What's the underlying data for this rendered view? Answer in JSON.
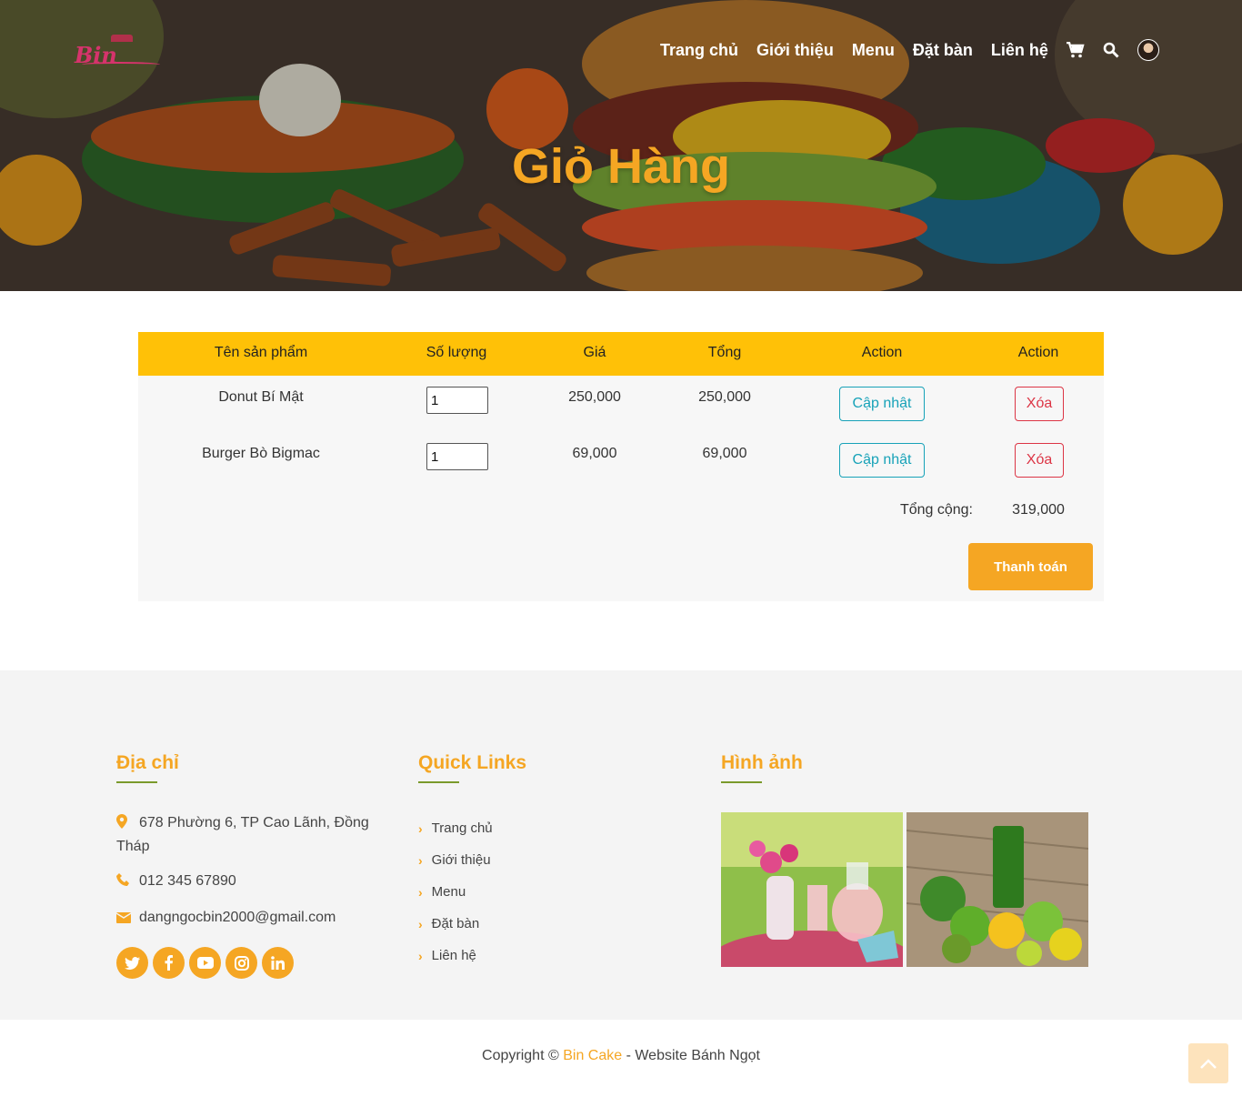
{
  "header": {
    "logo_text": "Bin",
    "nav": [
      "Trang chủ",
      "Giới thiệu",
      "Menu",
      "Đặt bàn",
      "Liên hệ"
    ],
    "icons": [
      "cart-icon",
      "search-icon",
      "avatar"
    ]
  },
  "hero": {
    "title": "Giỏ Hàng"
  },
  "cart": {
    "columns": [
      "Tên sản phẩm",
      "Số lượng",
      "Giá",
      "Tổng",
      "Action",
      "Action"
    ],
    "rows": [
      {
        "name": "Donut Bí Mật",
        "qty": "1",
        "price": "250,000",
        "total": "250,000",
        "update": "Cập nhật",
        "delete": "Xóa"
      },
      {
        "name": "Burger Bò Bigmac",
        "qty": "1",
        "price": "69,000",
        "total": "69,000",
        "update": "Cập nhật",
        "delete": "Xóa"
      }
    ],
    "grand_total_label": "Tổng cộng:",
    "grand_total": "319,000",
    "checkout": "Thanh toán"
  },
  "footer": {
    "address": {
      "title": "Địa chỉ",
      "street": "678 Phường 6, TP Cao Lãnh, Đồng Tháp",
      "phone": "012 345 67890",
      "email": "dangngocbin2000@gmail.com",
      "socials": [
        "twitter-icon",
        "facebook-icon",
        "youtube-icon",
        "instagram-icon",
        "linkedin-icon"
      ]
    },
    "quick_links": {
      "title": "Quick Links",
      "items": [
        "Trang chủ",
        "Giới thiệu",
        "Menu",
        "Đặt bàn",
        "Liên hệ"
      ]
    },
    "gallery": {
      "title": "Hình ảnh"
    }
  },
  "copyright": {
    "prefix": "Copyright ©",
    "brand": "Bin Cake",
    "suffix": "- Website Bánh Ngọt"
  },
  "colors": {
    "accent": "#f5a623",
    "table_header": "#ffc107",
    "update": "#17a2b8",
    "delete": "#dc3545",
    "green_line": "#7a9a2b"
  }
}
